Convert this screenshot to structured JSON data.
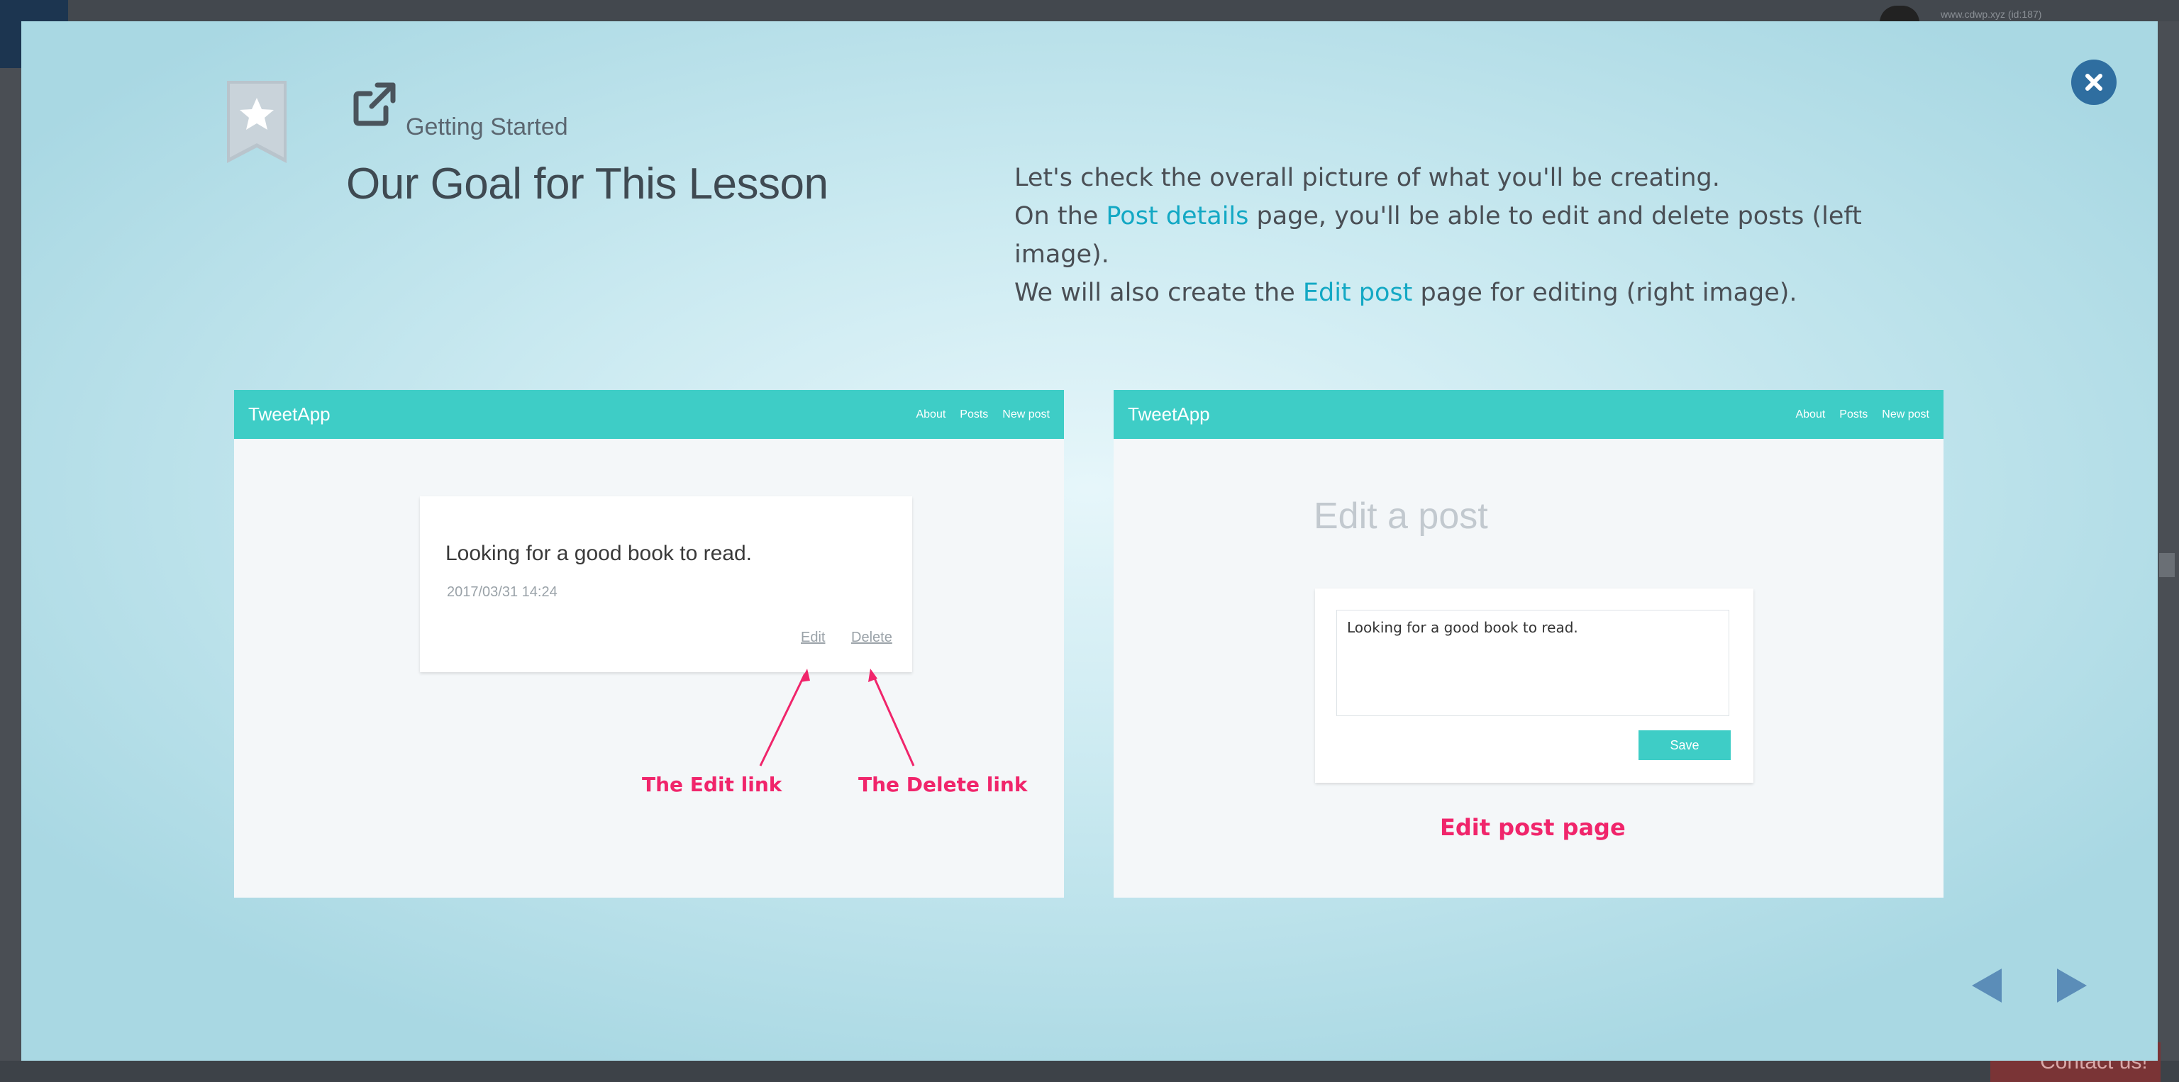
{
  "background_app": {
    "user_id": "www.cdwp.xyz (id:187)",
    "contact_label": "Contact us!"
  },
  "header": {
    "category": "Getting Started",
    "title": "Our Goal for This Lesson",
    "icon": "external-link-icon",
    "bookmark_icon": "star-bookmark-icon"
  },
  "description": {
    "line1": "Let's check the overall picture of what you'll be creating.",
    "line2_pre": "On the ",
    "line2_link": "Post details",
    "line2_post": " page, you'll be able to edit and delete posts (left image).",
    "line3_pre": "We will also create the ",
    "line3_link": "Edit post",
    "line3_post": " page for editing (right image)."
  },
  "left_preview": {
    "brand": "TweetApp",
    "nav": [
      "About",
      "Posts",
      "New post"
    ],
    "post_text": "Looking for a good book to read.",
    "post_date": "2017/03/31 14:24",
    "edit_link": "Edit",
    "delete_link": "Delete",
    "annotation_edit": "The Edit link",
    "annotation_delete": "The Delete link"
  },
  "right_preview": {
    "brand": "TweetApp",
    "nav": [
      "About",
      "Posts",
      "New post"
    ],
    "heading": "Edit a post",
    "textarea_value": "Looking for a good book to read.",
    "save_label": "Save",
    "annotation": "Edit post page"
  },
  "colors": {
    "accent": "#13a8c4",
    "navbar": "#3ecdc6",
    "annotation": "#f0256b",
    "close_button": "#2f6ea0",
    "arrow_button": "#5b8db8"
  }
}
